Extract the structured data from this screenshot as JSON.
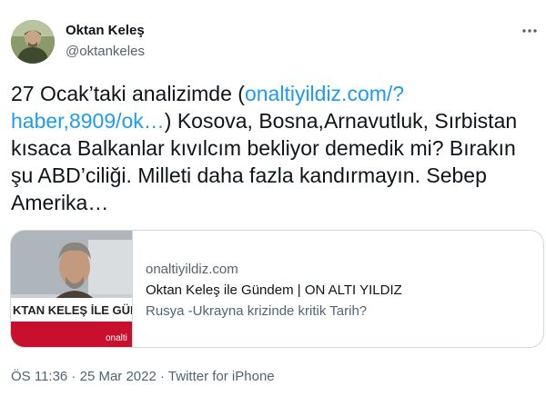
{
  "author": {
    "name": "Oktan Keleş",
    "handle": "@oktankeles"
  },
  "tweet": {
    "text_1": "27 Ocak’taki analizimde  (",
    "link_text": "onaltiyildiz.com/?haber,8909/ok…",
    "text_2": ") Kosova, Bosna,Arnavutluk, Sırbistan kısaca Balkanlar kıvılcım bekliyor demedik mi? Bırakın şu ABD’ciliği. Milleti daha fazla kandırmayın. Sebep Amerika…"
  },
  "card": {
    "domain": "onaltiyildiz.com",
    "title": "Oktan Keleş ile Gündem | ON ALTI YILDIZ",
    "description": "Rusya -Ukrayna krizinde kritik Tarih?",
    "thumb_caption": "KTAN KELEŞ İLE GÜNDE",
    "thumb_logo": "onalti"
  },
  "meta": {
    "time": "ÖS 11:36",
    "separator_1": " · ",
    "date": "25 Mar 2022",
    "separator_2": " · ",
    "source": "Twitter for iPhone"
  },
  "colors": {
    "link": "#1d9bf0",
    "muted": "#536471",
    "text": "#0f1419",
    "border": "#cfd9de",
    "thumb_banner": "#c8102e"
  }
}
